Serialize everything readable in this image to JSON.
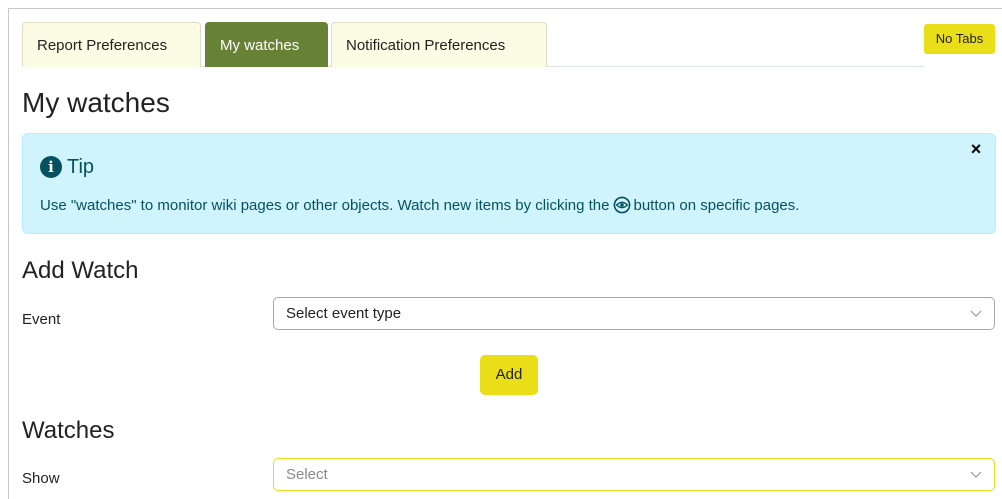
{
  "tabs": [
    {
      "label": "Report Preferences",
      "active": false
    },
    {
      "label": "My watches",
      "active": true
    },
    {
      "label": "Notification Preferences",
      "active": false
    }
  ],
  "no_tabs_label": "No Tabs",
  "page_title": "My watches",
  "tip": {
    "icon": "info-circle-icon",
    "title": "Tip",
    "text_before": "Use \"watches\" to monitor wiki pages or other objects. Watch new items by clicking the",
    "inline_icon": "eye-icon",
    "text_after": "button on specific pages.",
    "close_label": "×"
  },
  "add_watch": {
    "title": "Add Watch",
    "event_label": "Event",
    "event_select_value": "Select event type",
    "add_button": "Add"
  },
  "watches": {
    "title": "Watches",
    "show_label": "Show",
    "show_select_placeholder": "Select"
  },
  "colors": {
    "active_tab": "#678135",
    "inactive_tab": "#fcfbe3",
    "accent_yellow": "#e9de17",
    "tip_background": "#cff4fc",
    "tip_text": "#055160"
  }
}
